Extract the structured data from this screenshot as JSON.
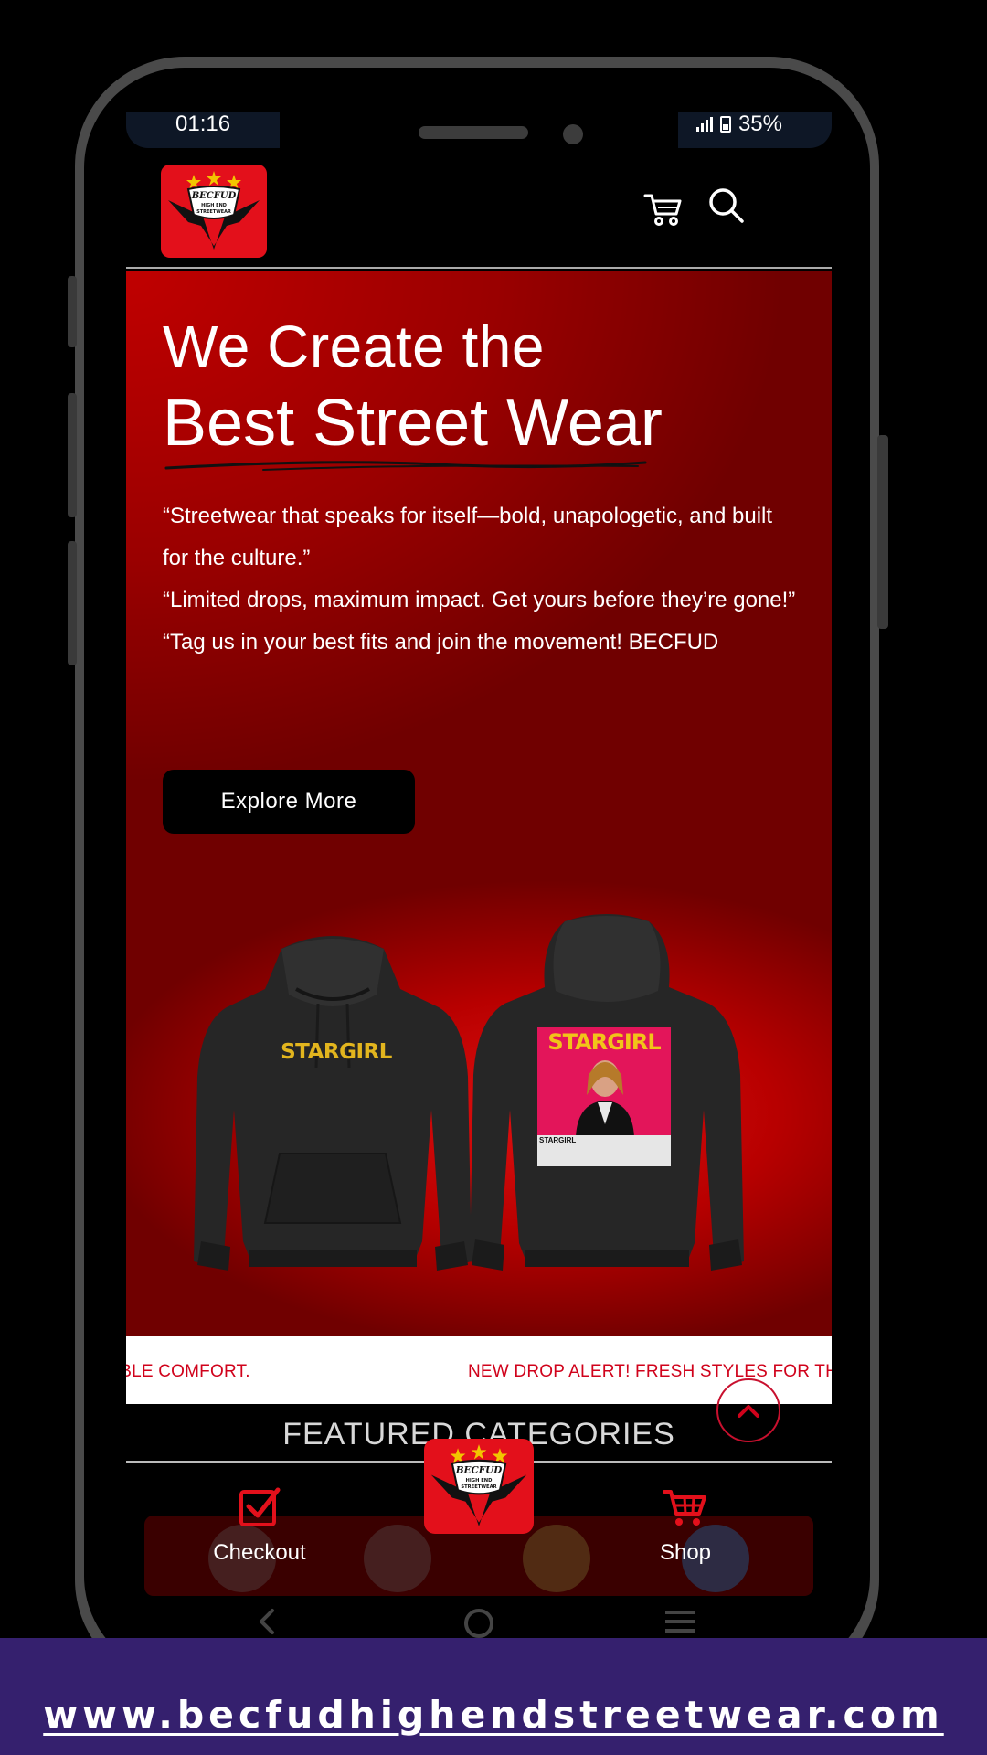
{
  "status_bar": {
    "time": "01:16",
    "battery": "35%"
  },
  "brand": {
    "logo_text_top": "BECFUD",
    "logo_text_mid": "HIGH END",
    "logo_text_bottom": "STREETWEAR",
    "accent_color": "#e3101b"
  },
  "header": {
    "cart_icon": "cart-icon",
    "search_icon": "search-icon"
  },
  "hero": {
    "title_line1": "We Create the",
    "title_line2": "Best Street Wear",
    "quote1": "“Streetwear that speaks for itself—bold, unapologetic, and built for the culture.”",
    "quote2": "“Limited drops, maximum impact. Get yours before they’re gone!”",
    "quote3": "“Tag us in your best fits and join the movement! BECFUD",
    "button_label": "Explore More",
    "product_front_text": "STARGIRL",
    "product_back_text": "STARGIRL",
    "poster_caption": "STARGIRL"
  },
  "ticker": {
    "text_a": "TABLE COMFORT.",
    "text_b": "NEW DROP ALERT! FRESH STYLES FOR THE N"
  },
  "featured": {
    "title": "FEATURED CATEGORIES"
  },
  "bottom_nav": {
    "checkout_label": "Checkout",
    "shop_label": "Shop"
  },
  "footer": {
    "url": "www.becfudhighendstreetwear.com"
  }
}
